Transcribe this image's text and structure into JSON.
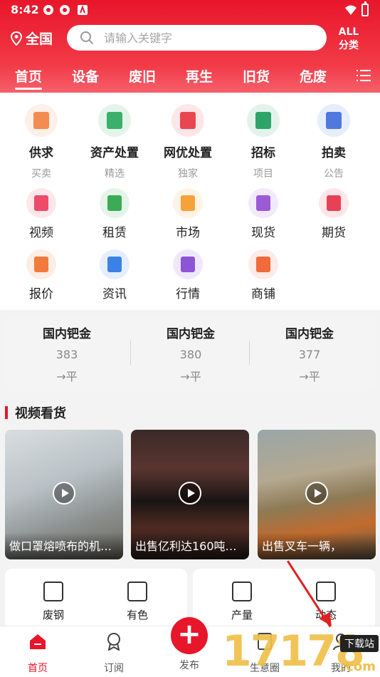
{
  "status": {
    "time": "8:42"
  },
  "header": {
    "location": "全国",
    "search_placeholder": "请输入关键字",
    "all_label": "ALL",
    "category_label": "分类"
  },
  "tabs": [
    "首页",
    "设备",
    "废旧",
    "再生",
    "旧货",
    "危废"
  ],
  "grid": {
    "row1": [
      {
        "label": "供求",
        "sub": "买卖",
        "color": "#f28c50"
      },
      {
        "label": "资产处置",
        "sub": "精选",
        "color": "#3bb06b"
      },
      {
        "label": "网优处置",
        "sub": "独家",
        "color": "#e8474f"
      },
      {
        "label": "招标",
        "sub": "项目",
        "color": "#2ea46a"
      },
      {
        "label": "拍卖",
        "sub": "公告",
        "color": "#4f79e0"
      }
    ],
    "row2": [
      {
        "label": "视频",
        "color": "#ee4a6a"
      },
      {
        "label": "租赁",
        "color": "#3cab55"
      },
      {
        "label": "市场",
        "color": "#f5a23a"
      },
      {
        "label": "现货",
        "color": "#9b5ad6"
      },
      {
        "label": "期货",
        "color": "#e84155"
      }
    ],
    "row3": [
      {
        "label": "报价",
        "color": "#f27a3c"
      },
      {
        "label": "资讯",
        "color": "#3b82e6"
      },
      {
        "label": "行情",
        "color": "#8d55d6"
      },
      {
        "label": "商铺",
        "color": "#f06a3a"
      }
    ]
  },
  "prices": [
    {
      "title": "国内钯金",
      "value": "383",
      "change": "→平"
    },
    {
      "title": "国内钯金",
      "value": "380",
      "change": "→平"
    },
    {
      "title": "国内钯金",
      "value": "377",
      "change": "→平"
    }
  ],
  "section": {
    "title": "视频看货"
  },
  "videos": [
    {
      "caption": "做口罩熔喷布的机…"
    },
    {
      "caption": "出售亿利达160吨…"
    },
    {
      "caption": "出售叉车一辆，"
    }
  ],
  "categories": {
    "left": [
      "废钢",
      "有色"
    ],
    "right": [
      "产量",
      "动态"
    ]
  },
  "bottom_nav": [
    "首页",
    "订阅",
    "发布",
    "生意圈",
    "我的"
  ],
  "watermark": {
    "digits": "17178",
    "download": "下载站",
    "com": ".com"
  }
}
